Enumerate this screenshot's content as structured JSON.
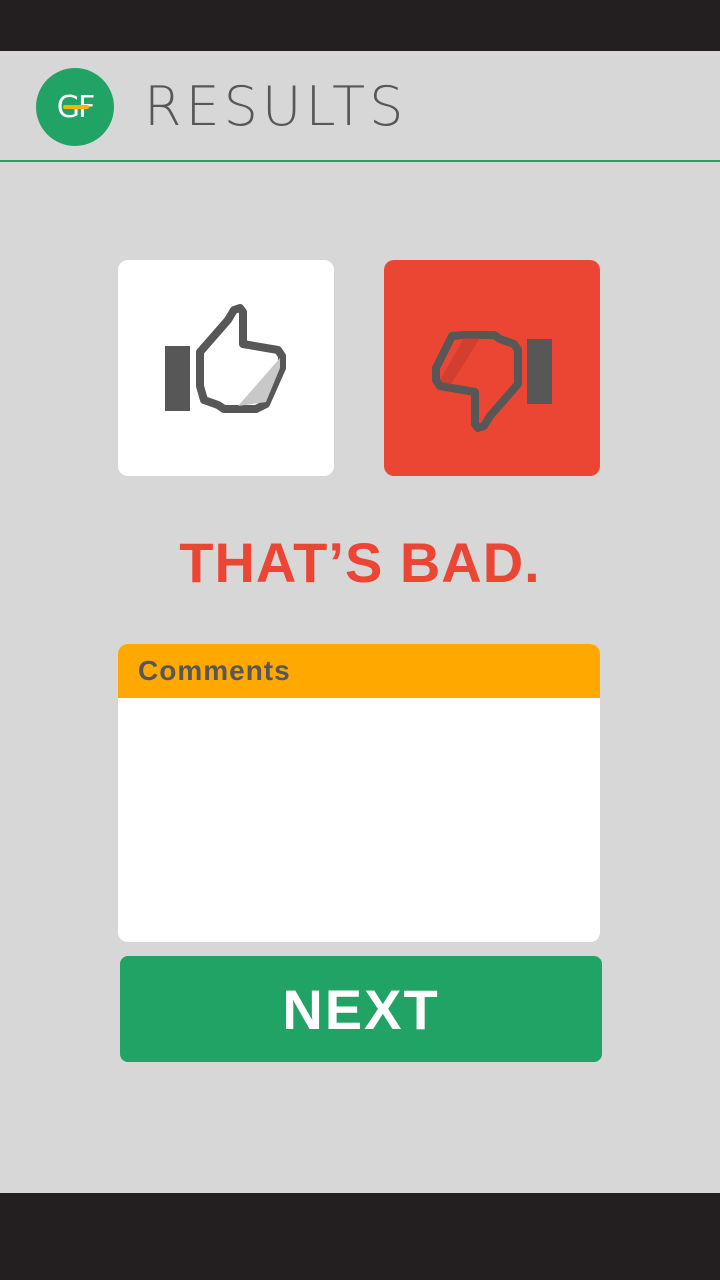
{
  "colors": {
    "status_bar": "#231f20",
    "nav_bar": "#231f20",
    "background": "#d7d7d7",
    "brand_green": "#22a366",
    "accent_red": "#ea4633",
    "comments_header": "#ffa800",
    "icon_gray": "#575757",
    "white": "#ffffff",
    "logo_bar": "#f7b500"
  },
  "header": {
    "logo_text": "GF",
    "title": "RESULTS"
  },
  "rating": {
    "thumbs_up_icon": "thumbs-up-icon",
    "thumbs_down_icon": "thumbs-down-icon",
    "selected": "down",
    "verdict": "THAT’S BAD."
  },
  "comments": {
    "label": "Comments",
    "value": "",
    "placeholder": ""
  },
  "actions": {
    "next_label": "NEXT"
  }
}
